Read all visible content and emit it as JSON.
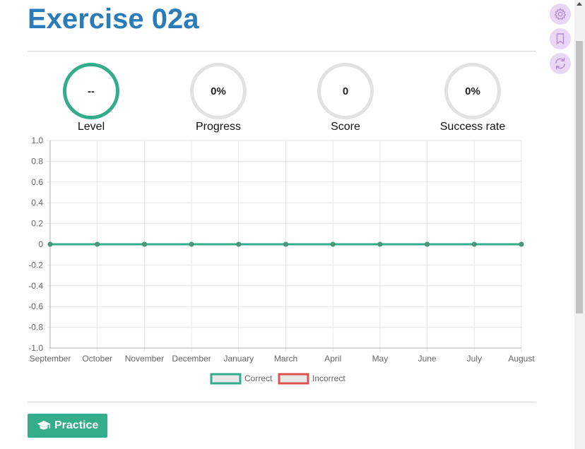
{
  "page": {
    "title": "Exercise 02a"
  },
  "stats": [
    {
      "value": "--",
      "label": "Level"
    },
    {
      "value": "0%",
      "label": "Progress"
    },
    {
      "value": "0",
      "label": "Score"
    },
    {
      "value": "0%",
      "label": "Success rate"
    }
  ],
  "chart_data": {
    "type": "line",
    "x": [
      "September",
      "October",
      "November",
      "December",
      "January",
      "March",
      "April",
      "May",
      "June",
      "July",
      "August"
    ],
    "y_ticks": [
      "1.0",
      "0.8",
      "0.6",
      "0.4",
      "0.2",
      "0",
      "-0.2",
      "-0.4",
      "-0.6",
      "-0.8",
      "-1.0"
    ],
    "ylim": [
      -1.0,
      1.0
    ],
    "series": [
      {
        "name": "Correct",
        "color": "#34ad8b",
        "values": [
          0,
          0,
          0,
          0,
          0,
          0,
          0,
          0,
          0,
          0,
          0
        ]
      },
      {
        "name": "Incorrect",
        "color": "#d9534f",
        "values": [
          0,
          0,
          0,
          0,
          0,
          0,
          0,
          0,
          0,
          0,
          0
        ]
      }
    ],
    "grid": true,
    "legend": "bottom"
  },
  "actions": {
    "practice_label": "Practice"
  },
  "sidebar_icons": [
    "gear-icon",
    "bookmark-icon",
    "refresh-icon"
  ],
  "colors": {
    "title": "#2b7bb9",
    "accent": "#34ad8b",
    "incorrect": "#d9534f",
    "side_button": "#ead6f5",
    "icon": "#b48fd0"
  }
}
